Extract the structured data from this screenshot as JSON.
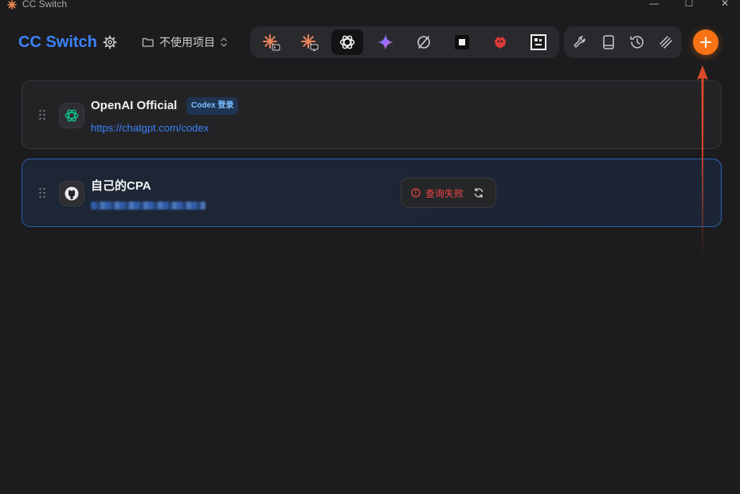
{
  "window": {
    "title": "CC Switch",
    "controls": {
      "minimize": "—",
      "maximize": "☐",
      "close": "✕"
    }
  },
  "header": {
    "brand": "CC Switch",
    "project_label": "不使用项目",
    "tools": [
      {
        "name": "claude-code-icon"
      },
      {
        "name": "claude-desktop-icon"
      },
      {
        "name": "openai-icon",
        "active": true
      },
      {
        "name": "gemini-icon"
      },
      {
        "name": "opencode-icon"
      },
      {
        "name": "square-icon"
      },
      {
        "name": "red-bird-icon"
      },
      {
        "name": "pixel-avatar-icon"
      }
    ],
    "utilities": [
      "wrench-icon",
      "book-icon",
      "history-icon",
      "stack-icon"
    ],
    "add_label": "+"
  },
  "providers": [
    {
      "name": "OpenAI Official",
      "badge": "Codex 登录",
      "url": "https://chatgpt.com/codex",
      "icon": "openai-icon"
    },
    {
      "name": "自己的CPA",
      "url_hidden": true,
      "icon": "github-icon",
      "status": "查询失败",
      "selected": true
    }
  ],
  "colors": {
    "accent": "#3b82f6",
    "add_button": "#f97316",
    "error": "#ef4444",
    "badge_text": "#7cc0ff"
  }
}
